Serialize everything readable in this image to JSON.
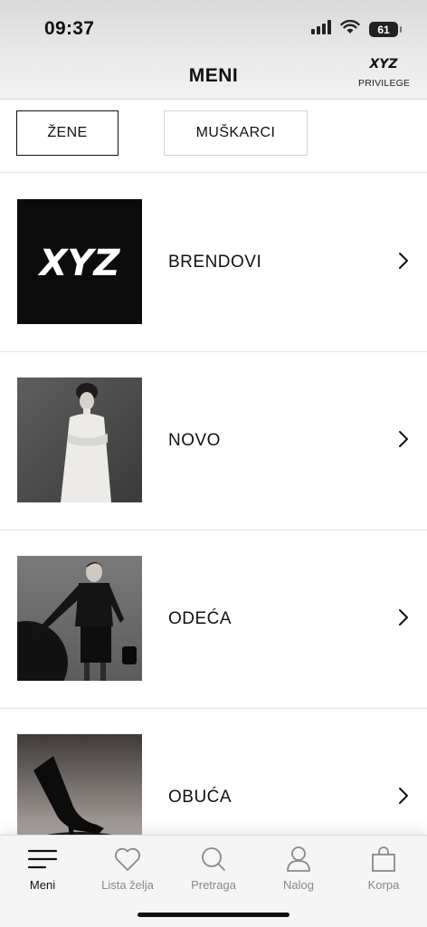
{
  "status_bar": {
    "time": "09:37",
    "battery": "61"
  },
  "header": {
    "title": "MENI",
    "privilege_label": "PRIVILEGE",
    "logo_text": "XYZ"
  },
  "tabs": [
    {
      "label": "ŽENE",
      "selected": true
    },
    {
      "label": "MUŠKARCI",
      "selected": false
    }
  ],
  "menu": [
    {
      "label": "BRENDOVI",
      "image": "brand-logo",
      "logo_text": "XYZ"
    },
    {
      "label": "NOVO",
      "image": "model-white-dress"
    },
    {
      "label": "ODEĆA",
      "image": "model-black-suit"
    },
    {
      "label": "OBUĆA",
      "image": "black-boot"
    }
  ],
  "bottom_nav": [
    {
      "label": "Meni",
      "icon": "menu-icon",
      "active": true
    },
    {
      "label": "Lista želja",
      "icon": "heart-icon",
      "active": false
    },
    {
      "label": "Pretraga",
      "icon": "search-icon",
      "active": false
    },
    {
      "label": "Nalog",
      "icon": "user-icon",
      "active": false
    },
    {
      "label": "Korpa",
      "icon": "bag-icon",
      "active": false
    }
  ],
  "colors": {
    "text": "#111111",
    "inactive": "#8a8a8a",
    "divider": "#e4e4e4"
  }
}
